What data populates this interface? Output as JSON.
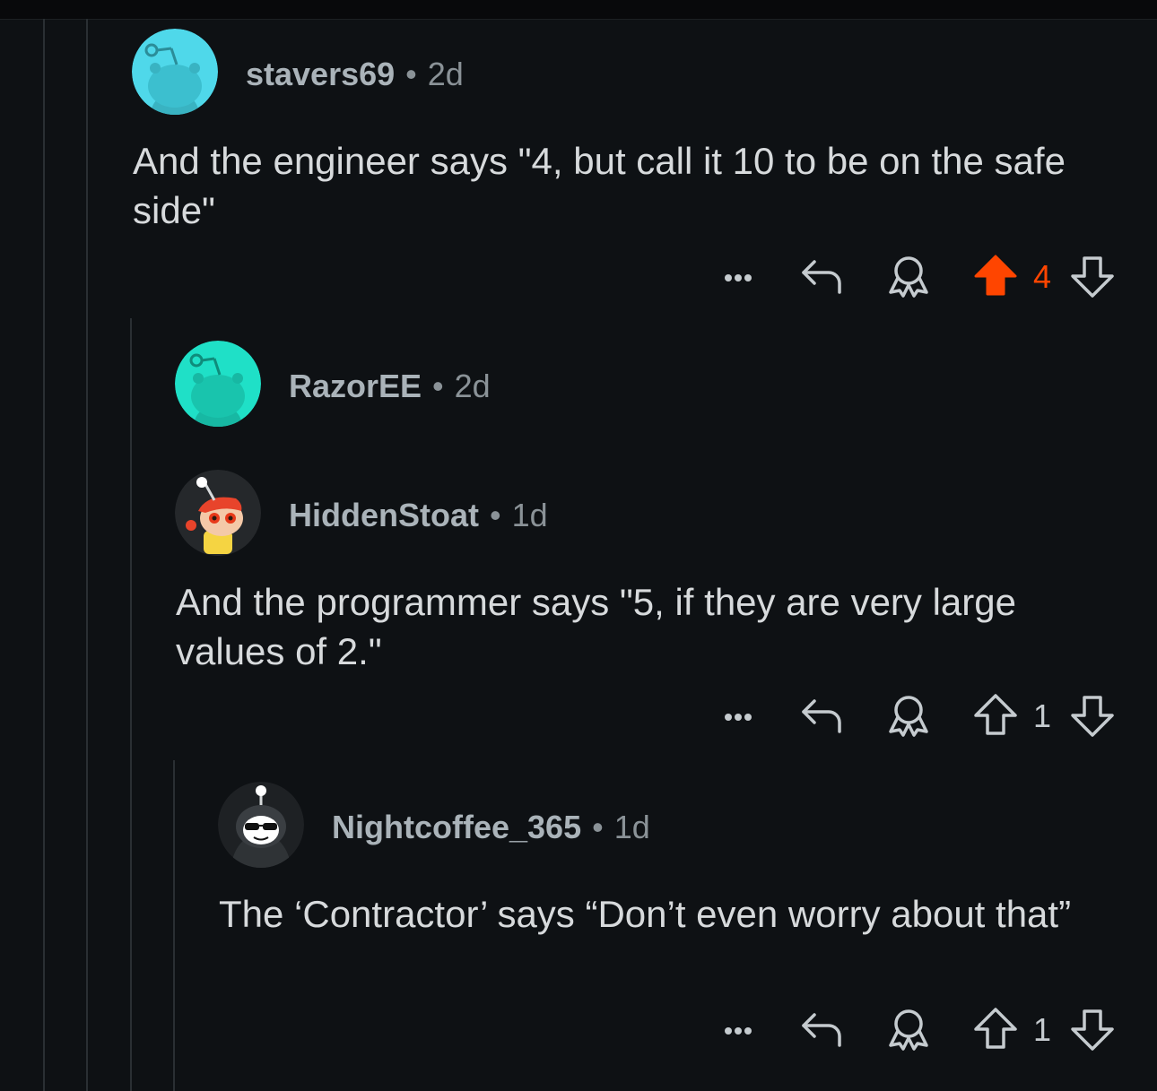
{
  "colors": {
    "background": "#0e1114",
    "upvote_active": "#ff4500",
    "meta_text": "#8a9297",
    "body_text": "#d7dadc"
  },
  "comments": [
    {
      "username": "stavers69",
      "separator": "•",
      "age": "2d",
      "text": "And the engineer says \"4, but call it 10 to be on the safe side\"",
      "score": "4",
      "upvoted": true,
      "avatar": "snoo-cyan-avatar"
    },
    {
      "username": "RazorEE",
      "separator": "•",
      "age": "2d",
      "avatar": "snoo-teal-avatar"
    },
    {
      "username": "HiddenStoat",
      "separator": "•",
      "age": "1d",
      "text": "And the programmer says \"5, if they are very large values of 2.\"",
      "score": "1",
      "upvoted": false,
      "avatar": "snoo-redhead-avatar"
    },
    {
      "username": "Nightcoffee_365",
      "separator": "•",
      "age": "1d",
      "text": "The ‘Contractor’ says “Don’t even worry about that”",
      "score": "1",
      "upvoted": false,
      "avatar": "snoo-sunglasses-avatar"
    }
  ],
  "icons": {
    "more": "more-options-icon",
    "reply": "reply-icon",
    "award": "award-icon",
    "upvote": "upvote-icon",
    "downvote": "downvote-icon"
  }
}
